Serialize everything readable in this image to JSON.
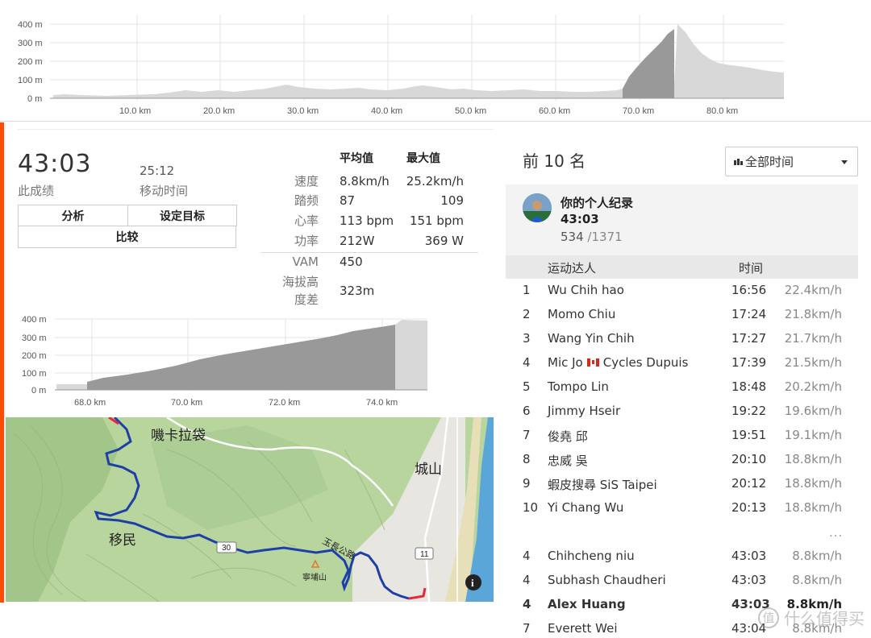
{
  "top_chart": {
    "y_ticks": [
      "400 m",
      "300 m",
      "200 m",
      "100 m",
      "0 m"
    ],
    "x_ticks": [
      "10.0 km",
      "20.0 km",
      "30.0 km",
      "40.0 km",
      "50.0 km",
      "60.0 km",
      "70.0 km",
      "80.0 km"
    ]
  },
  "effort": {
    "time": "43:03",
    "time_label": "此成绩",
    "moving_time": "25:12",
    "moving_time_label": "移动时间",
    "buttons": {
      "analyze": "分析",
      "set_goal": "设定目标",
      "compare": "比较"
    }
  },
  "stats": {
    "avg_header": "平均值",
    "max_header": "最大值",
    "rows": [
      {
        "label": "速度",
        "avg": "8.8km/h",
        "max": "25.2km/h"
      },
      {
        "label": "踏频",
        "avg": "87",
        "max": "109"
      },
      {
        "label": "心率",
        "avg": "113 bpm",
        "max": "151 bpm"
      },
      {
        "label": "功率",
        "avg": "212W",
        "max": "369 W"
      }
    ],
    "vam_label": "VAM",
    "vam": "450",
    "elev_label_1": "海拔高",
    "elev_label_2": "度差",
    "elev": "323m"
  },
  "small_chart": {
    "y_ticks": [
      "400 m",
      "300 m",
      "200 m",
      "100 m",
      "0 m"
    ],
    "x_ticks": [
      "68.0 km",
      "70.0 km",
      "72.0 km",
      "74.0 km"
    ]
  },
  "map": {
    "labels": {
      "place1": "嘰卡拉袋",
      "place2": "移民",
      "place3": "城山",
      "road_30": "30",
      "road_11": "11",
      "peak": "寧埔山",
      "road_name": "玉長公路",
      "info": "i"
    },
    "colors": {
      "terrain": "#b7d49d",
      "sea": "#5aa6d9",
      "route": "#1f3fa8",
      "route_end": "#e8263b"
    }
  },
  "leaderboard": {
    "title": "前 10 名",
    "filter": "全部时间",
    "pr": {
      "title": "你的个人纪录",
      "time": "43:03",
      "rank": "534",
      "total": "/1371"
    },
    "header_athlete": "运动达人",
    "header_time": "时间",
    "top10": [
      {
        "rank": "1",
        "name": "Wu Chih hao",
        "time": "16:56",
        "speed": "22.4km/h"
      },
      {
        "rank": "2",
        "name": "Momo Chiu",
        "time": "17:24",
        "speed": "21.8km/h"
      },
      {
        "rank": "3",
        "name": "Wang Yin Chih",
        "time": "17:27",
        "speed": "21.7km/h"
      },
      {
        "rank": "4",
        "name_a": "Mic Jo",
        "name_b": "Cycles Dupuis",
        "time": "17:39",
        "speed": "21.5km/h"
      },
      {
        "rank": "5",
        "name": "Tompo Lin",
        "time": "18:48",
        "speed": "20.2km/h"
      },
      {
        "rank": "6",
        "name": "Jimmy Hseir",
        "time": "19:22",
        "speed": "19.6km/h"
      },
      {
        "rank": "7",
        "name": "俊堯 邱",
        "time": "19:51",
        "speed": "19.1km/h"
      },
      {
        "rank": "8",
        "name": "忠威 吳",
        "time": "20:10",
        "speed": "18.8km/h"
      },
      {
        "rank": "9",
        "name": "蝦皮搜尋 SiS Taipei",
        "time": "20:12",
        "speed": "18.8km/h"
      },
      {
        "rank": "10",
        "name": "Yi Chang Wu",
        "time": "20:13",
        "speed": "18.8km/h"
      }
    ],
    "ellipsis": "...",
    "nearby": [
      {
        "rank": "4",
        "name": "Chihcheng niu",
        "time": "43:03",
        "speed": "8.8km/h"
      },
      {
        "rank": "4",
        "name": "Subhash Chaudheri",
        "time": "43:03",
        "speed": "8.8km/h"
      },
      {
        "rank": "4",
        "name": "Alex Huang",
        "time": "43:03",
        "speed": "8.8km/h"
      },
      {
        "rank": "7",
        "name": "Everett Wei",
        "time": "43:04",
        "speed": "8.8km/h"
      }
    ]
  },
  "watermark": {
    "logo": "值",
    "text": "什么值得买"
  }
}
